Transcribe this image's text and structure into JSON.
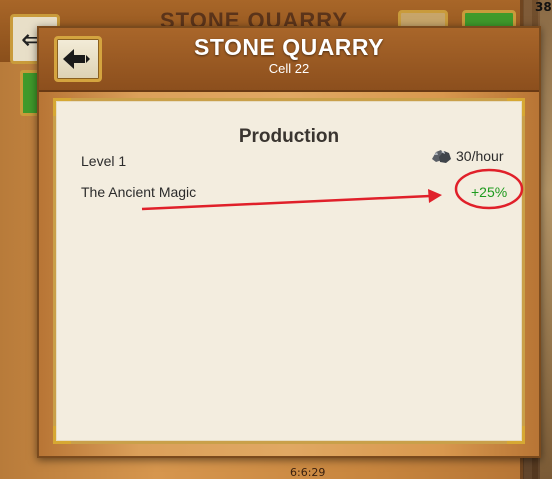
{
  "background": {
    "title": "STONE QUARRY",
    "top_right_number": "38",
    "bottom_text": "6:6:29"
  },
  "window": {
    "title": "STONE QUARRY",
    "subtitle": "Cell 22"
  },
  "production": {
    "heading": "Production",
    "rows": [
      {
        "label": "Level 1",
        "value": "30/hour",
        "icon": "stone-icon"
      },
      {
        "label": "The Ancient Magic",
        "value": "+25%"
      }
    ]
  },
  "colors": {
    "bonus": "#1e9a1e",
    "annotation": "#e0202a",
    "header": "#8c4f1d"
  },
  "icons": [
    "back-arrow-icon",
    "stone-icon"
  ]
}
